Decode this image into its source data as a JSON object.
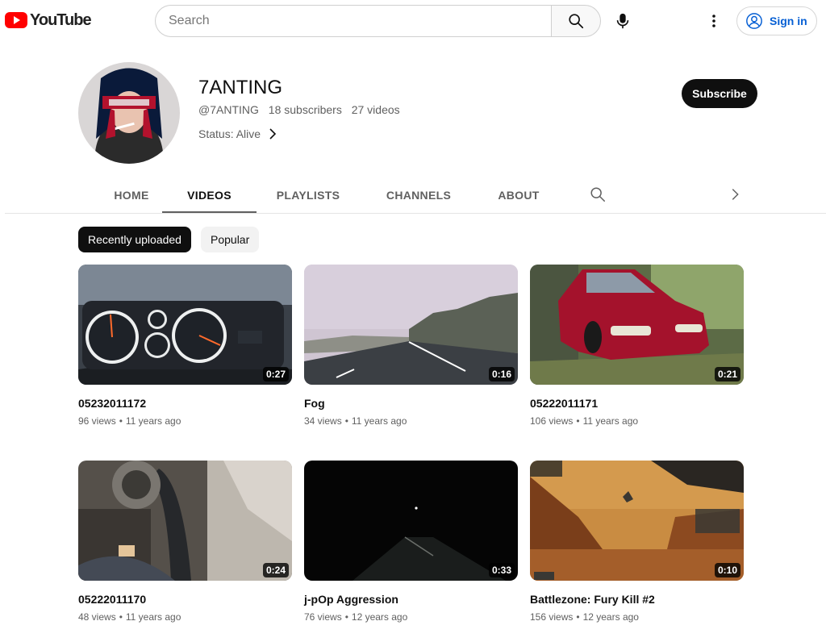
{
  "header": {
    "logo_text": "YouTube",
    "search_placeholder": "Search",
    "signin_label": "Sign in"
  },
  "channel": {
    "name": "7ANTING",
    "handle": "@7ANTING",
    "subscribers": "18 subscribers",
    "videos_count": "27 videos",
    "status": "Status: Alive",
    "subscribe_label": "Subscribe"
  },
  "tabs": [
    {
      "label": "HOME",
      "active": false
    },
    {
      "label": "VIDEOS",
      "active": true
    },
    {
      "label": "PLAYLISTS",
      "active": false
    },
    {
      "label": "CHANNELS",
      "active": false
    },
    {
      "label": "ABOUT",
      "active": false
    }
  ],
  "chips": [
    {
      "label": "Recently uploaded",
      "active": true
    },
    {
      "label": "Popular",
      "active": false
    }
  ],
  "videos": [
    {
      "title": "05232011172",
      "views": "96 views",
      "age": "11 years ago",
      "duration": "0:27"
    },
    {
      "title": "Fog",
      "views": "34 views",
      "age": "11 years ago",
      "duration": "0:16"
    },
    {
      "title": "05222011171",
      "views": "106 views",
      "age": "11 years ago",
      "duration": "0:21"
    },
    {
      "title": "05222011170",
      "views": "48 views",
      "age": "11 years ago",
      "duration": "0:24"
    },
    {
      "title": "j-pOp Aggression",
      "views": "76 views",
      "age": "12 years ago",
      "duration": "0:33"
    },
    {
      "title": "Battlezone: Fury Kill #2",
      "views": "156 views",
      "age": "12 years ago",
      "duration": "0:10"
    }
  ],
  "colors": {
    "brand_red": "#ff0000",
    "link_blue": "#065fd4",
    "text_primary": "#0f0f0f",
    "text_secondary": "#606060"
  }
}
